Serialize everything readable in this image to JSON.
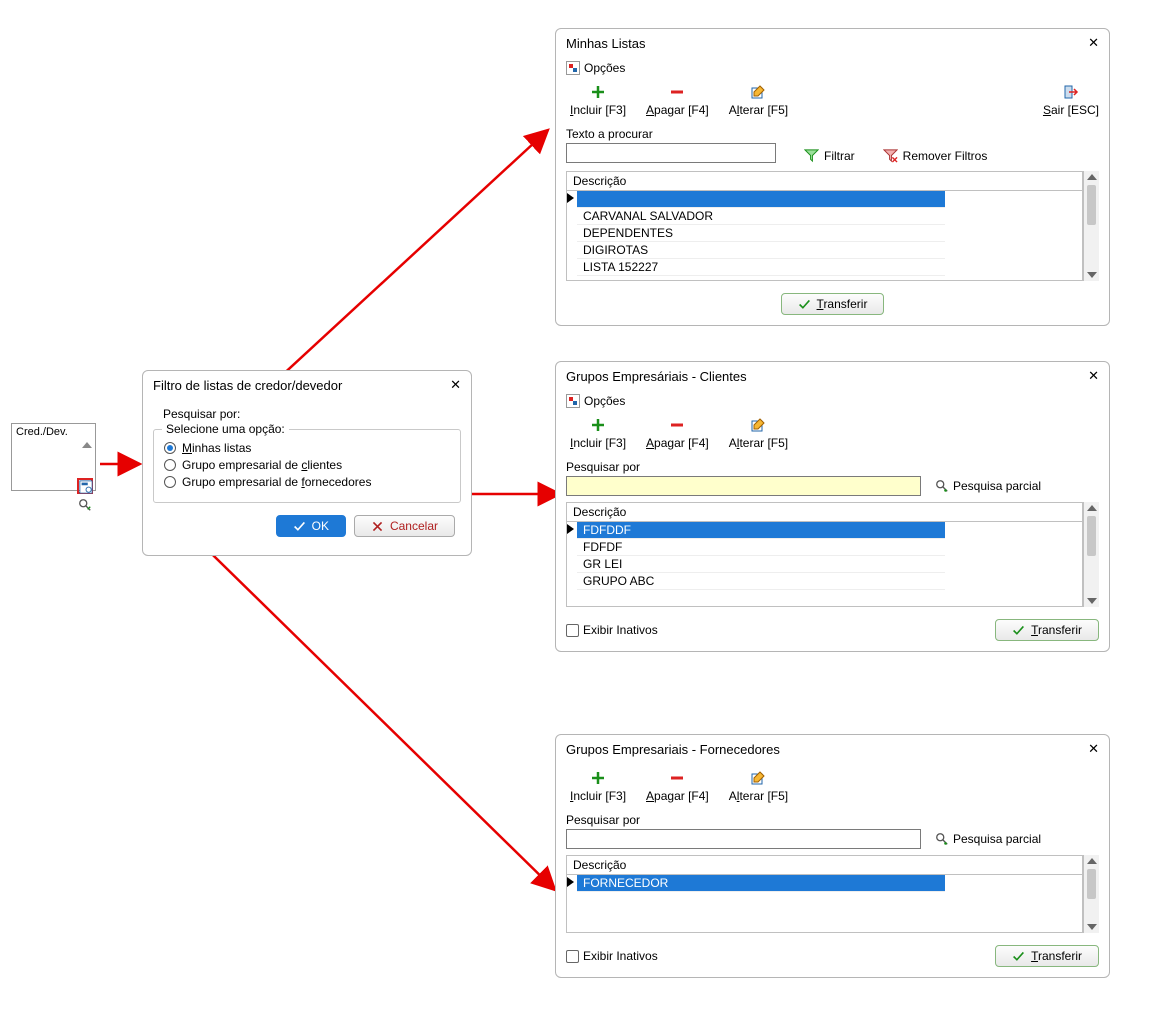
{
  "origin": {
    "header": "Cred./Dev."
  },
  "filter_dialog": {
    "title": "Filtro de listas de credor/devedor",
    "search_label": "Pesquisar por:",
    "group_legend": "Selecione uma opção:",
    "radios": [
      {
        "label": "Minhas listas",
        "checked": true
      },
      {
        "label": "Grupo empresarial de clientes",
        "checked": false
      },
      {
        "label": "Grupo empresarial de fornecedores",
        "checked": false
      }
    ],
    "ok": "OK",
    "cancel": "Cancelar"
  },
  "win1": {
    "title": "Minhas Listas",
    "opcoes": "Opções",
    "toolbar": {
      "incluir": "Incluir [F3]",
      "apagar": "Apagar [F4]",
      "alterar": "Alterar [F5]",
      "sair": "Sair [ESC]"
    },
    "search_label": "Texto a procurar",
    "filter": "Filtrar",
    "remove_filters": "Remover Filtros",
    "grid_header": "Descrição",
    "rows": [
      "",
      "CARVANAL SALVADOR",
      "DEPENDENTES",
      "DIGIROTAS",
      "LISTA 152227"
    ],
    "transfer": "Transferir"
  },
  "win2": {
    "title": "Grupos Empresáriais - Clientes",
    "opcoes": "Opções",
    "toolbar": {
      "incluir": "Incluir [F3]",
      "apagar": "Apagar [F4]",
      "alterar": "Alterar [F5]"
    },
    "search_label": "Pesquisar por",
    "pesquisa": "Pesquisa parcial",
    "grid_header": "Descrição",
    "rows": [
      "FDFDDF",
      "FDFDF",
      "GR LEI",
      "GRUPO ABC"
    ],
    "exibir": "Exibir Inativos",
    "transfer": "Transferir"
  },
  "win3": {
    "title": "Grupos Empresariais - Fornecedores",
    "toolbar": {
      "incluir": "Incluir [F3]",
      "apagar": "Apagar [F4]",
      "alterar": "Alterar [F5]"
    },
    "search_label": "Pesquisar por",
    "pesquisa": "Pesquisa parcial",
    "grid_header": "Descrição",
    "rows": [
      "FORNECEDOR"
    ],
    "exibir": "Exibir Inativos",
    "transfer": "Transferir"
  }
}
